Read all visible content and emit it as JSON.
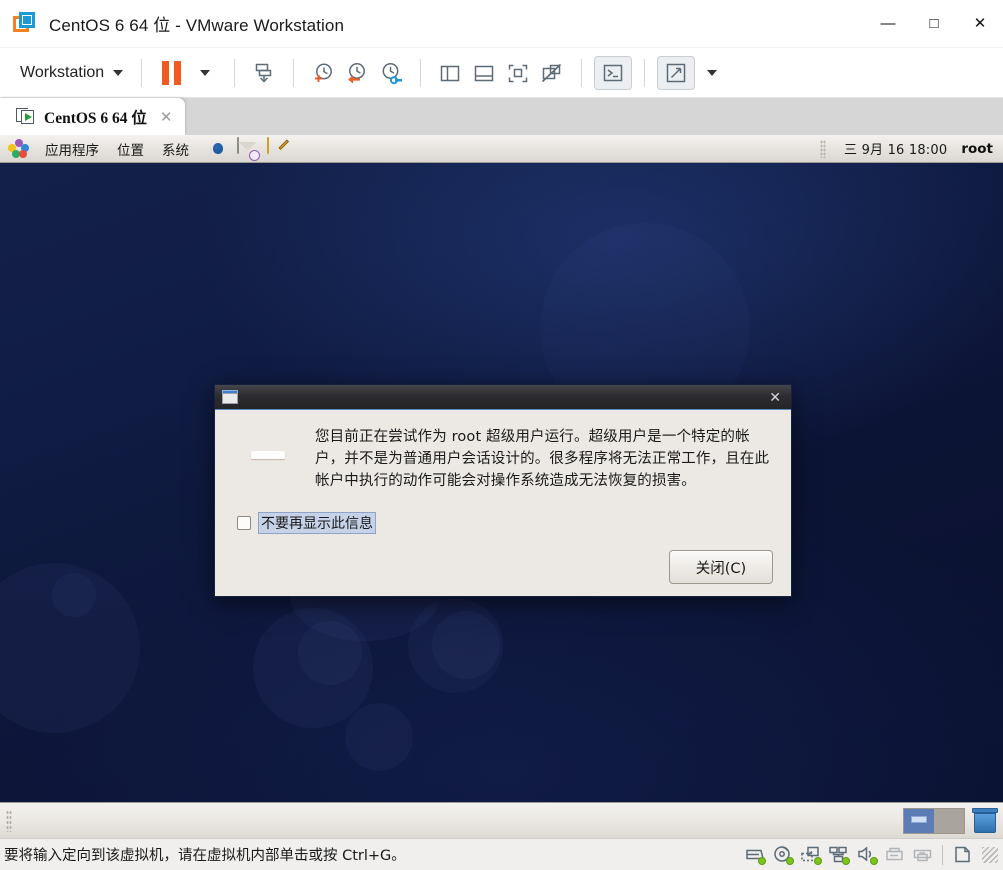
{
  "window": {
    "title": "CentOS 6 64 位 - VMware Workstation",
    "logo_icon": "vmware-logo-icon",
    "controls": {
      "minimize": "—",
      "maximize": "□",
      "close": "✕"
    }
  },
  "toolbar": {
    "menu_label": "Workstation",
    "items": [
      {
        "name": "workstation-menu",
        "label": "Workstation",
        "icon": "chevron-down-icon"
      },
      {
        "name": "suspend-button",
        "label": "",
        "icon": "pause-icon"
      },
      {
        "name": "suspend-dropdown",
        "label": "",
        "icon": "chevron-down-icon"
      },
      {
        "name": "power-button",
        "label": "",
        "icon": "power-vm-icon"
      },
      {
        "name": "take-snapshot-button",
        "label": "",
        "icon": "snapshot-add-icon"
      },
      {
        "name": "revert-snapshot-button",
        "label": "",
        "icon": "snapshot-revert-icon"
      },
      {
        "name": "snapshot-manager-button",
        "label": "",
        "icon": "snapshot-manager-icon"
      },
      {
        "name": "show-library-button",
        "label": "",
        "icon": "panel-left-icon"
      },
      {
        "name": "show-thumbnails-button",
        "label": "",
        "icon": "panel-bottom-icon"
      },
      {
        "name": "fullscreen-button",
        "label": "",
        "icon": "fullscreen-icon"
      },
      {
        "name": "unity-mode-button",
        "label": "",
        "icon": "unity-off-icon"
      },
      {
        "name": "console-view-button",
        "label": "",
        "icon": "console-icon"
      },
      {
        "name": "stretch-guest-button",
        "label": "",
        "icon": "stretch-icon"
      },
      {
        "name": "stretch-dropdown",
        "label": "",
        "icon": "chevron-down-icon"
      }
    ]
  },
  "tabs": [
    {
      "label": "CentOS 6 64 位",
      "icon": "vm-running-icon",
      "close": "✕",
      "active": true
    }
  ],
  "guest": {
    "top_panel": {
      "logo_icon": "centos-foot-icon",
      "menus": [
        "应用程序",
        "位置",
        "系统"
      ],
      "launchers": [
        {
          "name": "firefox-launcher",
          "icon": "firefox-icon"
        },
        {
          "name": "evolution-launcher",
          "icon": "evolution-mail-icon"
        },
        {
          "name": "gedit-launcher",
          "icon": "text-editor-icon"
        }
      ],
      "clock": "三 9月 16 18:00",
      "user": "root"
    },
    "bottom_panel": {
      "workspaces": [
        {
          "name": "workspace-1",
          "active": true
        },
        {
          "name": "workspace-2",
          "active": false
        }
      ],
      "trash_icon": "trash-icon"
    },
    "dialog": {
      "titlebar_icon": "window-icon",
      "close_label": "✕",
      "alert_icon": "error-stop-icon",
      "message": "您目前正在尝试作为 root 超级用户运行。超级用户是一个特定的帐户，并不是为普通用户会话设计的。很多程序将无法正常工作，且在此帐户中执行的动作可能会对操作系统造成无法恢复的损害。",
      "checkbox_label": "不要再显示此信息",
      "checkbox_checked": false,
      "close_button": "关闭(C)"
    }
  },
  "statusbar": {
    "message": "要将输入定向到该虚拟机，请在虚拟机内部单击或按 Ctrl+G。",
    "devices": [
      {
        "name": "hard-disk-device-icon",
        "connected": true
      },
      {
        "name": "cd-dvd-device-icon",
        "connected": true
      },
      {
        "name": "floppy-device-icon",
        "connected": true
      },
      {
        "name": "network-device-icon",
        "connected": true
      },
      {
        "name": "sound-device-icon",
        "connected": true
      },
      {
        "name": "usb-device-icon",
        "connected": false
      },
      {
        "name": "printer-device-icon",
        "connected": false
      },
      {
        "name": "document-device-icon",
        "connected": false
      }
    ]
  },
  "colors": {
    "accent_orange": "#f15a22",
    "accent_blue": "#1c9ad6",
    "desktop_navy": "#101c44",
    "alert_red": "#e02b22",
    "status_green": "#7dc41f"
  }
}
